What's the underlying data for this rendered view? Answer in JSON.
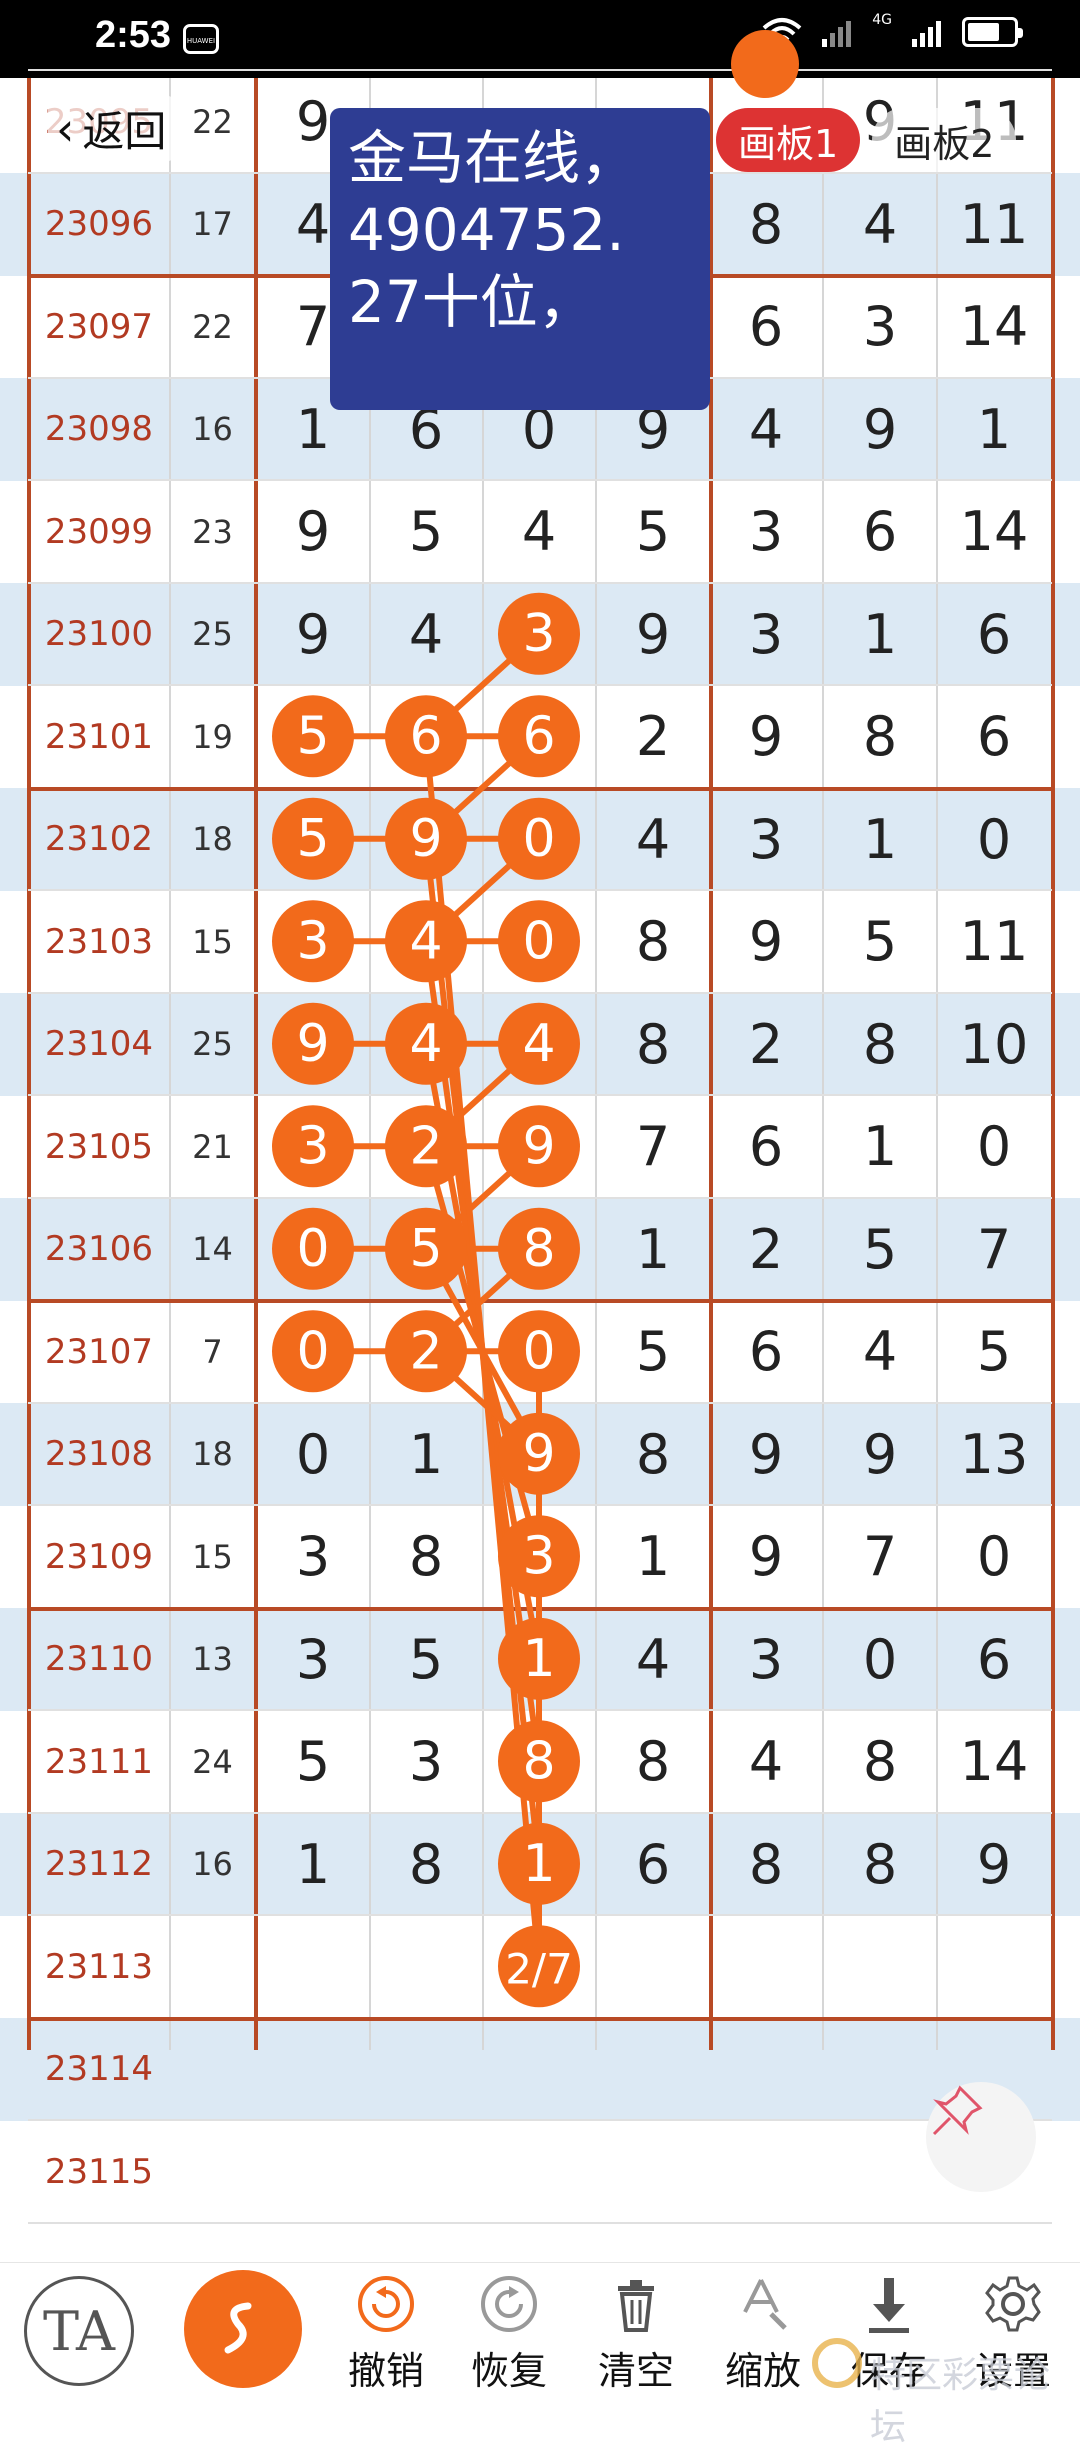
{
  "status_bar": {
    "time": "2:53",
    "carrier_badge": "HUAWEI",
    "network_label": "4G",
    "battery_level_fraction": 0.7
  },
  "nav": {
    "back_label": "返回"
  },
  "note": {
    "lines": [
      "金马在线，",
      " 4904752.",
      " 27十位，"
    ]
  },
  "boards": {
    "tab1": "画板1",
    "tab2": "画板2",
    "active": 1
  },
  "table": {
    "rows": [
      {
        "issue": "23095",
        "sum": "22",
        "digits": [
          "9",
          "",
          "",
          "",
          "",
          "9",
          "11"
        ]
      },
      {
        "issue": "23096",
        "sum": "17",
        "digits": [
          "4",
          "",
          "",
          "",
          "8",
          "4",
          "11"
        ]
      },
      {
        "issue": "23097",
        "sum": "22",
        "digits": [
          "7",
          "",
          "",
          "",
          "6",
          "3",
          "14"
        ]
      },
      {
        "issue": "23098",
        "sum": "16",
        "digits": [
          "1",
          "6",
          "0",
          "9",
          "4",
          "9",
          "1"
        ]
      },
      {
        "issue": "23099",
        "sum": "23",
        "digits": [
          "9",
          "5",
          "4",
          "5",
          "3",
          "6",
          "14"
        ]
      },
      {
        "issue": "23100",
        "sum": "25",
        "digits": [
          "9",
          "4",
          "3",
          "9",
          "3",
          "1",
          "6"
        ]
      },
      {
        "issue": "23101",
        "sum": "19",
        "digits": [
          "5",
          "6",
          "6",
          "2",
          "9",
          "8",
          "6"
        ]
      },
      {
        "issue": "23102",
        "sum": "18",
        "digits": [
          "5",
          "9",
          "0",
          "4",
          "3",
          "1",
          "0"
        ]
      },
      {
        "issue": "23103",
        "sum": "15",
        "digits": [
          "3",
          "4",
          "0",
          "8",
          "9",
          "5",
          "11"
        ]
      },
      {
        "issue": "23104",
        "sum": "25",
        "digits": [
          "9",
          "4",
          "4",
          "8",
          "2",
          "8",
          "10"
        ]
      },
      {
        "issue": "23105",
        "sum": "21",
        "digits": [
          "3",
          "2",
          "9",
          "7",
          "6",
          "1",
          "0"
        ]
      },
      {
        "issue": "23106",
        "sum": "14",
        "digits": [
          "0",
          "5",
          "8",
          "1",
          "2",
          "5",
          "7"
        ]
      },
      {
        "issue": "23107",
        "sum": "7",
        "digits": [
          "0",
          "2",
          "0",
          "5",
          "6",
          "4",
          "5"
        ]
      },
      {
        "issue": "23108",
        "sum": "18",
        "digits": [
          "0",
          "1",
          "9",
          "8",
          "9",
          "9",
          "13"
        ]
      },
      {
        "issue": "23109",
        "sum": "15",
        "digits": [
          "3",
          "8",
          "3",
          "1",
          "9",
          "7",
          "0"
        ]
      },
      {
        "issue": "23110",
        "sum": "13",
        "digits": [
          "3",
          "5",
          "1",
          "4",
          "3",
          "0",
          "6"
        ]
      },
      {
        "issue": "23111",
        "sum": "24",
        "digits": [
          "5",
          "3",
          "8",
          "8",
          "4",
          "8",
          "14"
        ]
      },
      {
        "issue": "23112",
        "sum": "16",
        "digits": [
          "1",
          "8",
          "1",
          "6",
          "8",
          "8",
          "9"
        ]
      },
      {
        "issue": "23113",
        "sum": "",
        "digits": [
          "",
          "",
          "2/7",
          "",
          "",
          "",
          ""
        ]
      },
      {
        "issue": "23114",
        "sum": "",
        "digits": [
          "",
          "",
          "",
          "",
          "",
          "",
          ""
        ]
      },
      {
        "issue": "23115",
        "sum": "",
        "digits": [
          "",
          "",
          "",
          "",
          "",
          "",
          ""
        ]
      }
    ],
    "highlights": [
      {
        "row": 5,
        "col": 2
      },
      {
        "row": 6,
        "col": 0
      },
      {
        "row": 6,
        "col": 1
      },
      {
        "row": 6,
        "col": 2
      },
      {
        "row": 7,
        "col": 0
      },
      {
        "row": 7,
        "col": 1
      },
      {
        "row": 7,
        "col": 2
      },
      {
        "row": 8,
        "col": 0
      },
      {
        "row": 8,
        "col": 1
      },
      {
        "row": 8,
        "col": 2
      },
      {
        "row": 9,
        "col": 0
      },
      {
        "row": 9,
        "col": 1
      },
      {
        "row": 9,
        "col": 2
      },
      {
        "row": 10,
        "col": 0
      },
      {
        "row": 10,
        "col": 1
      },
      {
        "row": 10,
        "col": 2
      },
      {
        "row": 11,
        "col": 0
      },
      {
        "row": 11,
        "col": 1
      },
      {
        "row": 11,
        "col": 2
      },
      {
        "row": 12,
        "col": 0
      },
      {
        "row": 12,
        "col": 1
      },
      {
        "row": 12,
        "col": 2
      },
      {
        "row": 13,
        "col": 2
      },
      {
        "row": 14,
        "col": 2
      },
      {
        "row": 15,
        "col": 2
      },
      {
        "row": 16,
        "col": 2
      },
      {
        "row": 17,
        "col": 2
      },
      {
        "row": 18,
        "col": 2
      }
    ],
    "links": [
      [
        [
          5,
          2
        ],
        [
          6,
          1
        ]
      ],
      [
        [
          6,
          0
        ],
        [
          6,
          1
        ],
        [
          6,
          2
        ]
      ],
      [
        [
          7,
          0
        ],
        [
          7,
          1
        ],
        [
          7,
          2
        ]
      ],
      [
        [
          8,
          0
        ],
        [
          8,
          1
        ],
        [
          8,
          2
        ]
      ],
      [
        [
          9,
          0
        ],
        [
          9,
          1
        ],
        [
          9,
          2
        ]
      ],
      [
        [
          10,
          0
        ],
        [
          10,
          1
        ],
        [
          10,
          2
        ]
      ],
      [
        [
          11,
          0
        ],
        [
          11,
          1
        ],
        [
          11,
          2
        ]
      ],
      [
        [
          12,
          0
        ],
        [
          12,
          1
        ],
        [
          12,
          2
        ]
      ],
      [
        [
          6,
          2
        ],
        [
          7,
          1
        ]
      ],
      [
        [
          7,
          2
        ],
        [
          8,
          1
        ]
      ],
      [
        [
          9,
          2
        ],
        [
          10,
          1
        ]
      ],
      [
        [
          10,
          2
        ],
        [
          11,
          1
        ]
      ],
      [
        [
          11,
          2
        ],
        [
          12,
          1
        ]
      ],
      [
        [
          7,
          1
        ],
        [
          17,
          2
        ]
      ],
      [
        [
          8,
          1
        ],
        [
          16,
          2
        ]
      ],
      [
        [
          9,
          1
        ],
        [
          15,
          2
        ]
      ],
      [
        [
          10,
          1
        ],
        [
          14,
          2
        ]
      ],
      [
        [
          11,
          1
        ],
        [
          13,
          2
        ]
      ],
      [
        [
          12,
          1
        ],
        [
          13,
          2
        ]
      ],
      [
        [
          6,
          1
        ],
        [
          18,
          2
        ]
      ],
      [
        [
          12,
          2
        ],
        [
          18,
          2
        ]
      ]
    ]
  },
  "toolbar": {
    "items": [
      {
        "label": "撤销",
        "icon": "undo-icon"
      },
      {
        "label": "恢复",
        "icon": "redo-icon"
      },
      {
        "label": "清空",
        "icon": "trash-icon"
      },
      {
        "label": "缩放",
        "icon": "zoom-icon"
      },
      {
        "label": "保存",
        "icon": "download-icon"
      },
      {
        "label": "设置",
        "icon": "gear-icon"
      }
    ],
    "text_tool_label": "TA"
  },
  "watermark": "特区彩票论坛",
  "colors": {
    "accent_orange": "#f26a1b",
    "issue_red": "#b23a22",
    "note_bg": "#2e3d93",
    "tab_active": "#dd3333",
    "row_alt": "#dce9f4"
  }
}
